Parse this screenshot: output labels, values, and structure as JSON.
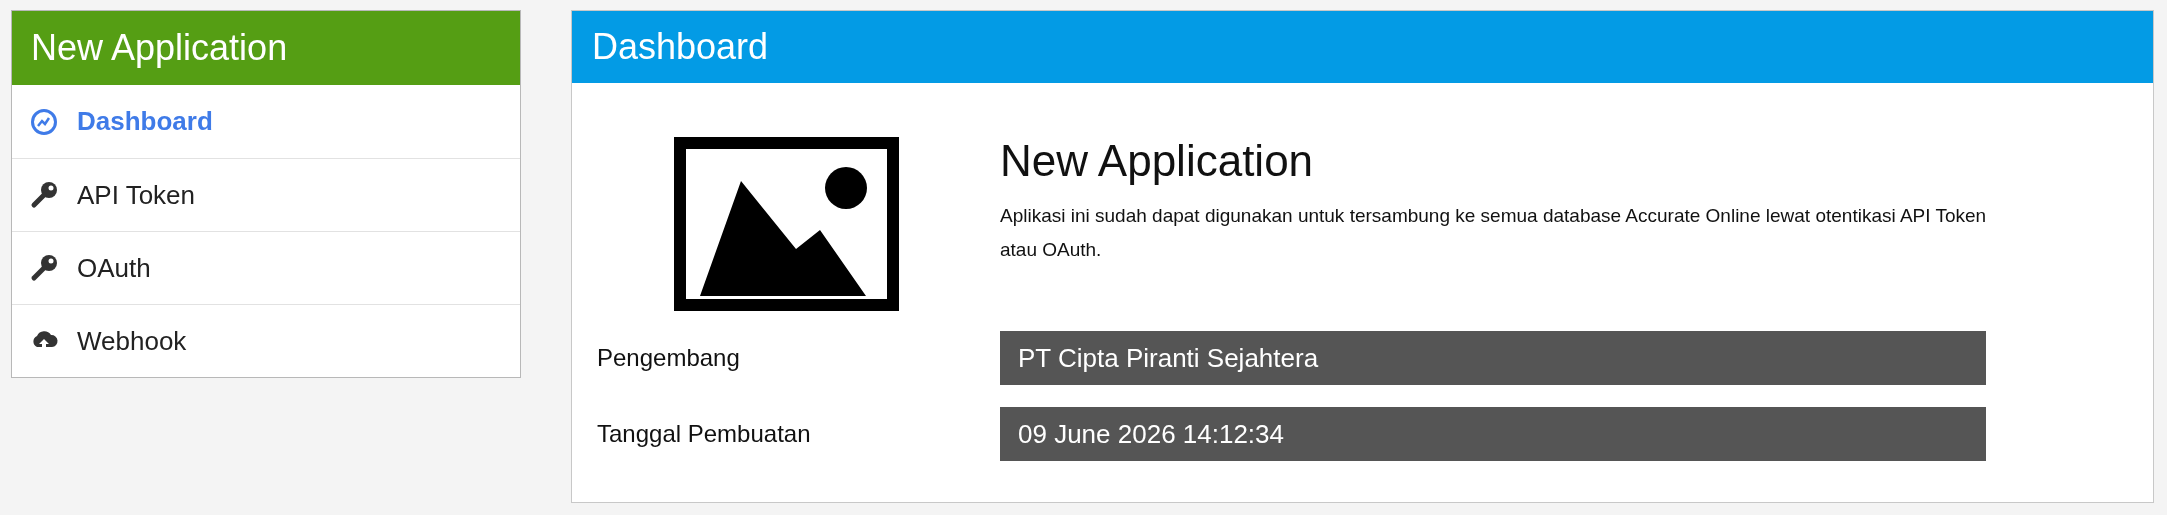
{
  "sidebar": {
    "title": "New Application",
    "items": [
      {
        "label": "Dashboard",
        "selected": true
      },
      {
        "label": "API Token",
        "selected": false
      },
      {
        "label": "OAuth",
        "selected": false
      },
      {
        "label": "Webhook",
        "selected": false
      }
    ]
  },
  "main": {
    "title": "Dashboard",
    "app_name": "New Application",
    "description": "Aplikasi ini sudah dapat digunakan untuk tersambung ke semua database Accurate Online lewat otentikasi API Token atau OAuth.",
    "fields": [
      {
        "label": "Pengembang",
        "value": "PT Cipta Piranti Sejahtera"
      },
      {
        "label": "Tanggal Pembuatan",
        "value": "09 June 2026 14:12:34"
      }
    ]
  }
}
